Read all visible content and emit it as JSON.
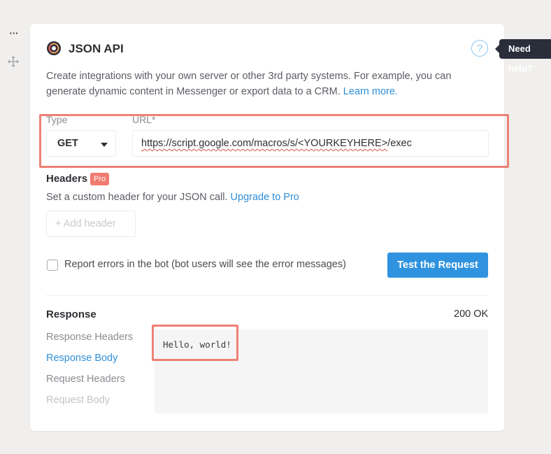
{
  "block": {
    "title": "JSON API",
    "help_icon": "question-icon",
    "tooltip": "Need help?",
    "description": "Create integrations with your own server or other 3rd party systems. For example, you can generate dynamic content in Messenger or export data to a CRM.",
    "learn_more": "Learn more."
  },
  "request": {
    "type_label": "Type",
    "type_value": "GET",
    "url_label": "URL*",
    "url_prefix": "https://script.google.com/macros/s/",
    "url_key": "<YOURKEYHERE>",
    "url_suffix": "/exec"
  },
  "headers": {
    "title": "Headers",
    "badge": "Pro",
    "description": "Set a custom header for your JSON call.",
    "upgrade_link": "Upgrade to Pro",
    "add_button": "+ Add header"
  },
  "options": {
    "report_errors_label": "Report errors in the bot (bot users will see the error messages)",
    "report_errors_checked": false,
    "test_button": "Test the Request"
  },
  "response": {
    "title": "Response",
    "status": "200 OK",
    "tabs": [
      {
        "label": "Response Headers",
        "state": "default"
      },
      {
        "label": "Response Body",
        "state": "active"
      },
      {
        "label": "Request Headers",
        "state": "default"
      },
      {
        "label": "Request Body",
        "state": "disabled"
      }
    ],
    "body": "Hello, world!"
  },
  "colors": {
    "accent": "#2f93e0",
    "link": "#2f8fd8",
    "highlight": "#ee8075",
    "pro_badge": "#f07b6e"
  }
}
